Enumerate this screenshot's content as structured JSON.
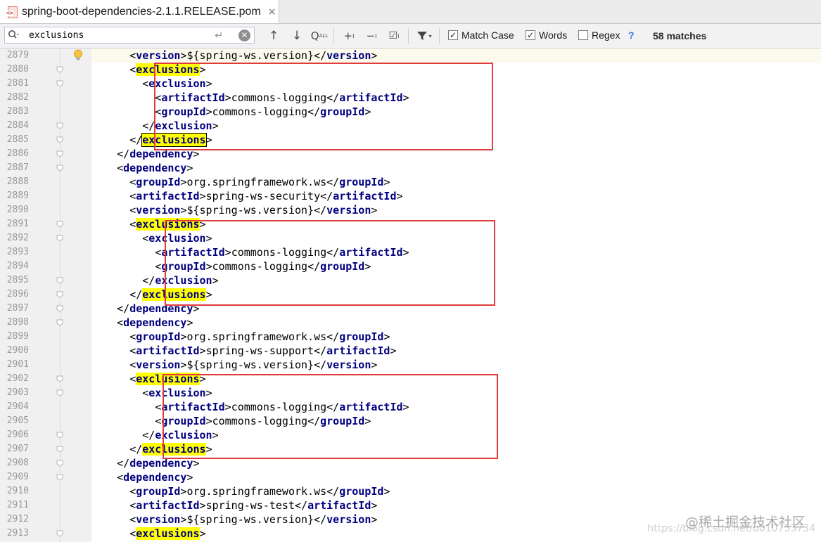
{
  "tab": {
    "title": "spring-boot-dependencies-2.1.1.RELEASE.pom",
    "close": "×",
    "file_icon": "maven-pom-file-icon"
  },
  "search": {
    "value": "exclusions",
    "icons": [
      "search-icon",
      "enter-icon",
      "clear-icon",
      "prev-occurrence-icon",
      "next-occurrence-icon",
      "find-in-selection-icon",
      "add-occurrence-icon",
      "remove-occurrence-icon",
      "select-all-occurrences-icon",
      "filter-icon"
    ],
    "match_case": {
      "label": "Match Case",
      "checked": true
    },
    "words": {
      "label": "Words",
      "checked": true
    },
    "regex": {
      "label": "Regex",
      "checked": false
    },
    "help": "?",
    "matches": "58 matches"
  },
  "editor": {
    "lines": [
      {
        "n": "2879",
        "parts": [
          [
            "i",
            6
          ],
          [
            "o",
            "version"
          ],
          [
            "t",
            "${spring-ws.version}"
          ],
          [
            "c",
            "version"
          ]
        ]
      },
      {
        "n": "2880",
        "parts": [
          [
            "i",
            6
          ],
          [
            "oh",
            "exclusions"
          ]
        ]
      },
      {
        "n": "2881",
        "parts": [
          [
            "i",
            8
          ],
          [
            "o",
            "exclusion"
          ]
        ]
      },
      {
        "n": "2882",
        "parts": [
          [
            "i",
            10
          ],
          [
            "o",
            "artifactId"
          ],
          [
            "t",
            "commons-logging"
          ],
          [
            "c",
            "artifactId"
          ]
        ]
      },
      {
        "n": "2883",
        "parts": [
          [
            "i",
            10
          ],
          [
            "o",
            "groupId"
          ],
          [
            "t",
            "commons-logging"
          ],
          [
            "c",
            "groupId"
          ]
        ]
      },
      {
        "n": "2884",
        "parts": [
          [
            "i",
            8
          ],
          [
            "c",
            "exclusion"
          ]
        ]
      },
      {
        "n": "2885",
        "parts": [
          [
            "i",
            6
          ],
          [
            "ch2",
            "exclusions"
          ]
        ]
      },
      {
        "n": "2886",
        "parts": [
          [
            "i",
            4
          ],
          [
            "c",
            "dependency"
          ]
        ]
      },
      {
        "n": "2887",
        "parts": [
          [
            "i",
            4
          ],
          [
            "o",
            "dependency"
          ]
        ]
      },
      {
        "n": "2888",
        "parts": [
          [
            "i",
            6
          ],
          [
            "o",
            "groupId"
          ],
          [
            "t",
            "org.springframework.ws"
          ],
          [
            "c",
            "groupId"
          ]
        ]
      },
      {
        "n": "2889",
        "parts": [
          [
            "i",
            6
          ],
          [
            "o",
            "artifactId"
          ],
          [
            "t",
            "spring-ws-security"
          ],
          [
            "c",
            "artifactId"
          ]
        ]
      },
      {
        "n": "2890",
        "parts": [
          [
            "i",
            6
          ],
          [
            "o",
            "version"
          ],
          [
            "t",
            "${spring-ws.version}"
          ],
          [
            "c",
            "version"
          ]
        ]
      },
      {
        "n": "2891",
        "parts": [
          [
            "i",
            6
          ],
          [
            "oh",
            "exclusions"
          ]
        ]
      },
      {
        "n": "2892",
        "parts": [
          [
            "i",
            8
          ],
          [
            "o",
            "exclusion"
          ]
        ]
      },
      {
        "n": "2893",
        "parts": [
          [
            "i",
            10
          ],
          [
            "o",
            "artifactId"
          ],
          [
            "t",
            "commons-logging"
          ],
          [
            "c",
            "artifactId"
          ]
        ]
      },
      {
        "n": "2894",
        "parts": [
          [
            "i",
            10
          ],
          [
            "o",
            "groupId"
          ],
          [
            "t",
            "commons-logging"
          ],
          [
            "c",
            "groupId"
          ]
        ]
      },
      {
        "n": "2895",
        "parts": [
          [
            "i",
            8
          ],
          [
            "c",
            "exclusion"
          ]
        ]
      },
      {
        "n": "2896",
        "parts": [
          [
            "i",
            6
          ],
          [
            "ch",
            "exclusions"
          ]
        ]
      },
      {
        "n": "2897",
        "parts": [
          [
            "i",
            4
          ],
          [
            "c",
            "dependency"
          ]
        ]
      },
      {
        "n": "2898",
        "parts": [
          [
            "i",
            4
          ],
          [
            "o",
            "dependency"
          ]
        ]
      },
      {
        "n": "2899",
        "parts": [
          [
            "i",
            6
          ],
          [
            "o",
            "groupId"
          ],
          [
            "t",
            "org.springframework.ws"
          ],
          [
            "c",
            "groupId"
          ]
        ]
      },
      {
        "n": "2900",
        "parts": [
          [
            "i",
            6
          ],
          [
            "o",
            "artifactId"
          ],
          [
            "t",
            "spring-ws-support"
          ],
          [
            "c",
            "artifactId"
          ]
        ]
      },
      {
        "n": "2901",
        "parts": [
          [
            "i",
            6
          ],
          [
            "o",
            "version"
          ],
          [
            "t",
            "${spring-ws.version}"
          ],
          [
            "c",
            "version"
          ]
        ]
      },
      {
        "n": "2902",
        "parts": [
          [
            "i",
            6
          ],
          [
            "oh",
            "exclusions"
          ]
        ]
      },
      {
        "n": "2903",
        "parts": [
          [
            "i",
            8
          ],
          [
            "o",
            "exclusion"
          ]
        ]
      },
      {
        "n": "2904",
        "parts": [
          [
            "i",
            10
          ],
          [
            "o",
            "artifactId"
          ],
          [
            "t",
            "commons-logging"
          ],
          [
            "c",
            "artifactId"
          ]
        ]
      },
      {
        "n": "2905",
        "parts": [
          [
            "i",
            10
          ],
          [
            "o",
            "groupId"
          ],
          [
            "t",
            "commons-logging"
          ],
          [
            "c",
            "groupId"
          ]
        ]
      },
      {
        "n": "2906",
        "parts": [
          [
            "i",
            8
          ],
          [
            "c",
            "exclusion"
          ]
        ]
      },
      {
        "n": "2907",
        "parts": [
          [
            "i",
            6
          ],
          [
            "ch",
            "exclusions"
          ]
        ]
      },
      {
        "n": "2908",
        "parts": [
          [
            "i",
            4
          ],
          [
            "c",
            "dependency"
          ]
        ]
      },
      {
        "n": "2909",
        "parts": [
          [
            "i",
            4
          ],
          [
            "o",
            "dependency"
          ]
        ]
      },
      {
        "n": "2910",
        "parts": [
          [
            "i",
            6
          ],
          [
            "o",
            "groupId"
          ],
          [
            "t",
            "org.springframework.ws"
          ],
          [
            "c",
            "groupId"
          ]
        ]
      },
      {
        "n": "2911",
        "parts": [
          [
            "i",
            6
          ],
          [
            "o",
            "artifactId"
          ],
          [
            "t",
            "spring-ws-test"
          ],
          [
            "c",
            "artifactId"
          ]
        ]
      },
      {
        "n": "2912",
        "parts": [
          [
            "i",
            6
          ],
          [
            "o",
            "version"
          ],
          [
            "t",
            "${spring-ws.version}"
          ],
          [
            "c",
            "version"
          ]
        ]
      },
      {
        "n": "2913",
        "parts": [
          [
            "i",
            6
          ],
          [
            "oh",
            "exclusions"
          ]
        ]
      }
    ],
    "fold_lines": [
      "2880",
      "2881",
      "2884",
      "2885",
      "2886",
      "2887",
      "2891",
      "2892",
      "2895",
      "2896",
      "2897",
      "2898",
      "2902",
      "2903",
      "2906",
      "2907",
      "2908",
      "2909",
      "2913"
    ],
    "caret_line": "2879",
    "highlight_color": "#ffff00",
    "annotation_color": "#e03c3c"
  },
  "watermark": {
    "brand": "@稀土掘金技术社区",
    "url": "https://blog.csdn.net/u010753734"
  }
}
